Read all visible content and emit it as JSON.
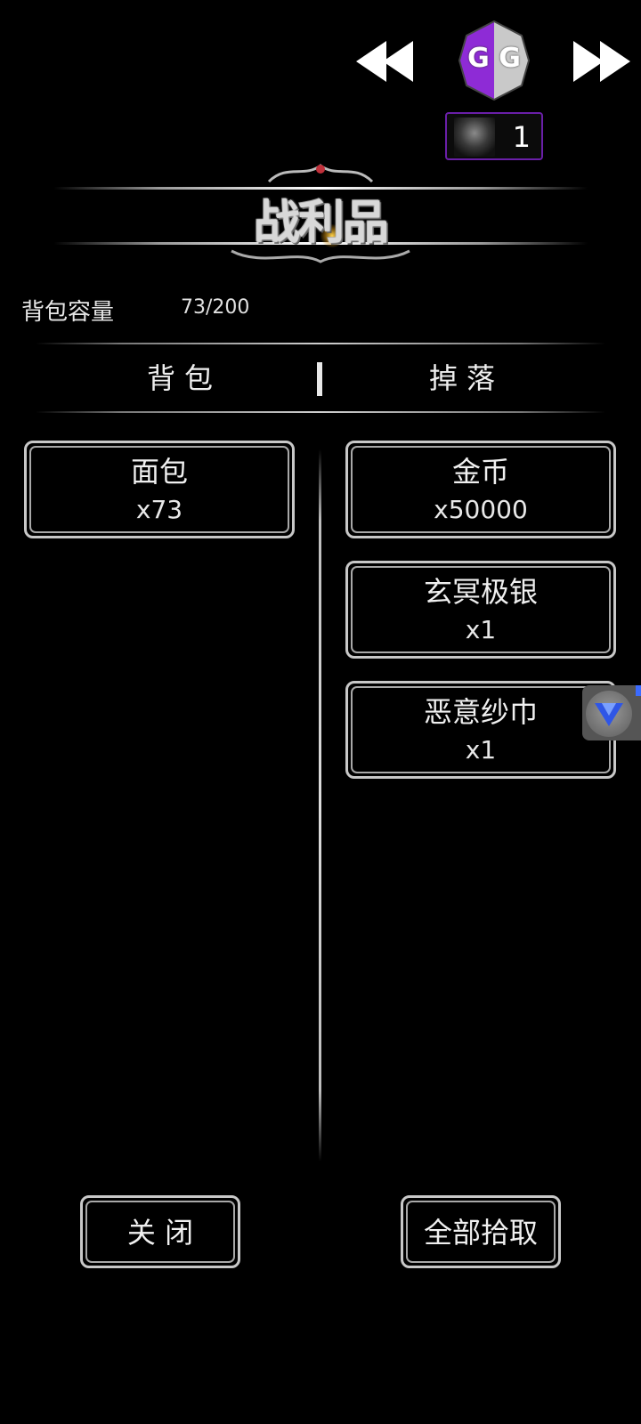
{
  "overlay": {
    "rewind_icon": "double-left-arrow",
    "forward_icon": "double-right-arrow",
    "logo_letters": "G G",
    "process_count": "1",
    "accent_color": "#8a2be2"
  },
  "panel": {
    "title": "战利品",
    "capacity_label": "背包容量",
    "capacity_value": "73/200"
  },
  "tabs": [
    {
      "label": "背包"
    },
    {
      "label": "掉落"
    }
  ],
  "backpack_items": [
    {
      "name": "面包",
      "qty": "x73"
    }
  ],
  "drop_items": [
    {
      "name": "金币",
      "qty": "x50000"
    },
    {
      "name": "玄冥极银",
      "qty": "x1"
    },
    {
      "name": "恶意纱巾",
      "qty": "x1"
    }
  ],
  "floating_button": {
    "icon": "v-shield-icon"
  },
  "actions": {
    "close_label": "关 闭",
    "pickup_all_label": "全部拾取"
  }
}
